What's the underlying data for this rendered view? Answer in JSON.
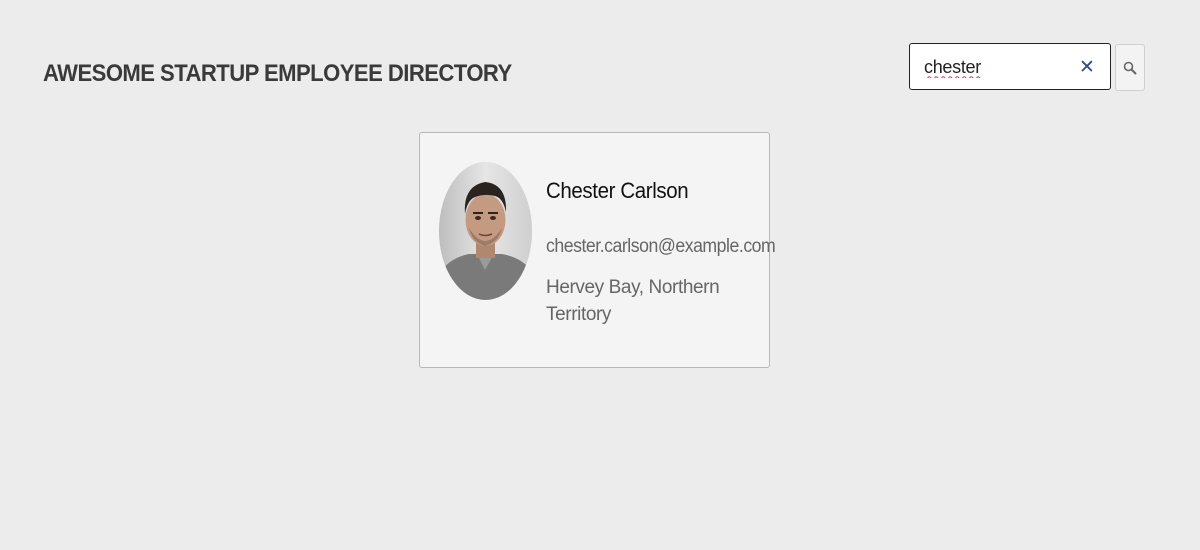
{
  "header": {
    "title": "AWESOME STARTUP EMPLOYEE DIRECTORY"
  },
  "search": {
    "value": "chester",
    "clear_icon": "close-icon",
    "button_icon": "search-icon"
  },
  "employees": [
    {
      "name": "Chester Carlson",
      "email": "chester.carlson@example.com",
      "location": "Hervey Bay, Northern Territory",
      "avatar_icon": "avatar-photo"
    }
  ],
  "colors": {
    "background": "#ececec",
    "card_background": "#f4f4f4",
    "card_border": "#b8b8b8",
    "clear_icon": "#2c4a86"
  }
}
